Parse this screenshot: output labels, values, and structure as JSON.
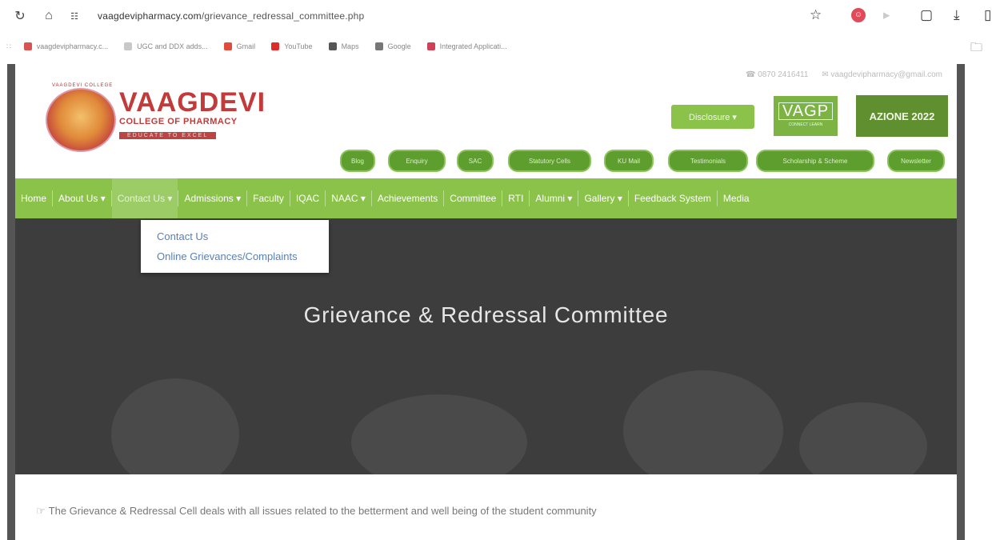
{
  "browser": {
    "url_host": "vaagdevipharmacy.com",
    "url_path": "/grievance_redressal_committee.php",
    "bookmarks": [
      {
        "label": "vaagdevipharmacy.c...",
        "color": "#d9534f"
      },
      {
        "label": "UGC and DDX adds...",
        "color": "#c8c8c8"
      },
      {
        "label": "Gmail",
        "color": "#e24a3b"
      },
      {
        "label": "YouTube",
        "color": "#e02b2b"
      },
      {
        "label": "Maps",
        "color": "#555555"
      },
      {
        "label": "Google",
        "color": "#777777"
      },
      {
        "label": "Integrated Applicati...",
        "color": "#d04057"
      }
    ]
  },
  "header": {
    "contact_phone": "☎ 0870 2416411",
    "contact_email": "✉ vaagdevipharmacy@gmail.com",
    "brand_name": "VAAGDEVI",
    "brand_sub": "COLLEGE OF PHARMACY",
    "brand_tag": "EDUCATE TO EXCEL",
    "logo_rim": "VAAGDEVI COLLEGE",
    "disclosure": "Disclosure ▾",
    "vagp": "VAGP",
    "vagp_small": "CONNECT LEARN",
    "azione": "AZIONE 2022",
    "pills": [
      "Blog",
      "Enquiry",
      "SAC",
      "Statutory Cells",
      "KU Mail",
      "Testimonials",
      "Scholarship & Scheme",
      "Newsletter"
    ]
  },
  "nav": {
    "items": [
      "Home",
      "About Us ▾",
      "Contact Us ▾",
      "Admissions ▾",
      "Faculty",
      "IQAC",
      "NAAC ▾",
      "Achievements",
      "Committee",
      "RTI",
      "Alumni ▾",
      "Gallery ▾",
      "Feedback System",
      "Media"
    ]
  },
  "dropdown": {
    "items": [
      "Contact Us",
      "Online Grievances/Complaints"
    ]
  },
  "hero": {
    "title": "Grievance & Redressal Committee"
  },
  "content": {
    "text": "The Grievance & Redressal Cell deals with all issues related to the betterment and well being of the student community"
  },
  "colors": {
    "nav_green": "#8bc34a",
    "brand_red": "#c33a3a",
    "pill_green": "#5e9e2e"
  }
}
